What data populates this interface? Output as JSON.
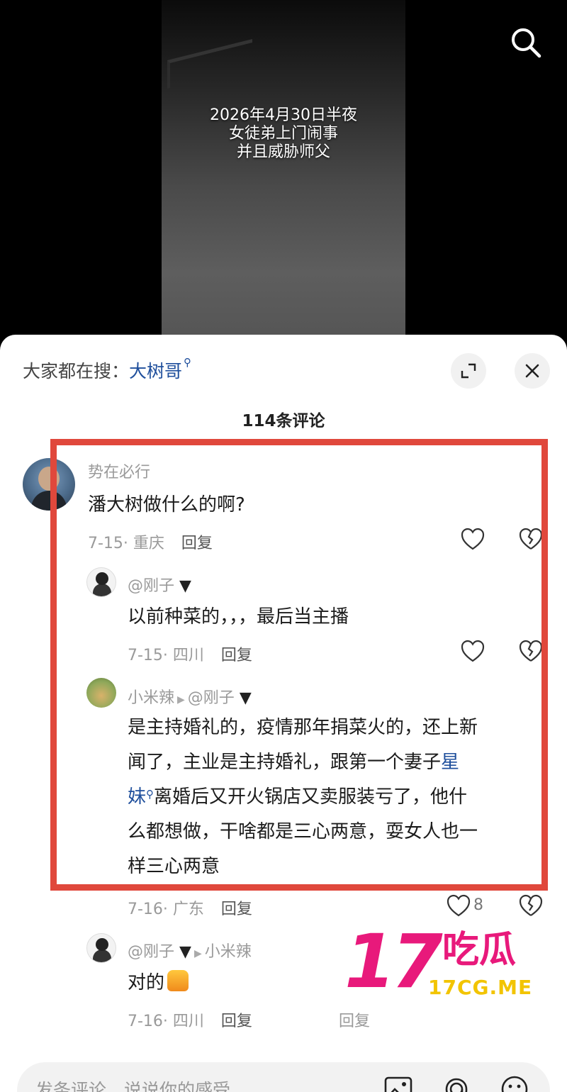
{
  "video": {
    "caption_lines": [
      "2026年4月30日半夜",
      "女徒弟上门闹事",
      "并且威胁师父"
    ]
  },
  "sheet": {
    "hot_search_prefix": "大家都在搜：",
    "hot_search_keyword": "大树哥",
    "comment_count_title": "114条评论"
  },
  "comments": [
    {
      "user": "势在必行",
      "text": "潘大树做什么的啊?",
      "date_location": "7-15· 重庆",
      "reply_label": "回复"
    },
    {
      "user": "@刚子",
      "text": "以前种菜的，，，最后当主播",
      "date_location": "7-15· 四川",
      "reply_label": "回复"
    },
    {
      "user": "小米辣",
      "reply_to": "@刚子",
      "text_line1": "是主持婚礼的，疫情那年捐菜火的，还上新",
      "text_line2_a": "闻了，主业是主持婚礼，跟第一个妻子",
      "text_line2_kw": "星",
      "text_line3_kw": "妹",
      "text_line3_b": "离婚后又开火锅店又卖服装亏了，他什",
      "text_line4": "么都想做，干啥都是三心两意，耍女人也一",
      "text_line5": "样三心两意",
      "date_location": "7-16· 广东",
      "reply_label": "回复",
      "likes": "8"
    },
    {
      "user": "@刚子",
      "reply_to": "小米辣",
      "text": "对的",
      "date_location": "7-16· 四川",
      "reply_label": "回复",
      "extra_reply_label": "回复"
    }
  ],
  "watermark": {
    "number": "17",
    "chinese": "吃瓜",
    "url": "17CG.ME"
  },
  "input_bar": {
    "placeholder": "发条评论，说说你的感受"
  },
  "colors": {
    "highlight_border": "#e0483c",
    "keyword_blue": "#1f4f9c",
    "watermark_pink": "#e8197b",
    "watermark_yellow": "#f2c400"
  }
}
